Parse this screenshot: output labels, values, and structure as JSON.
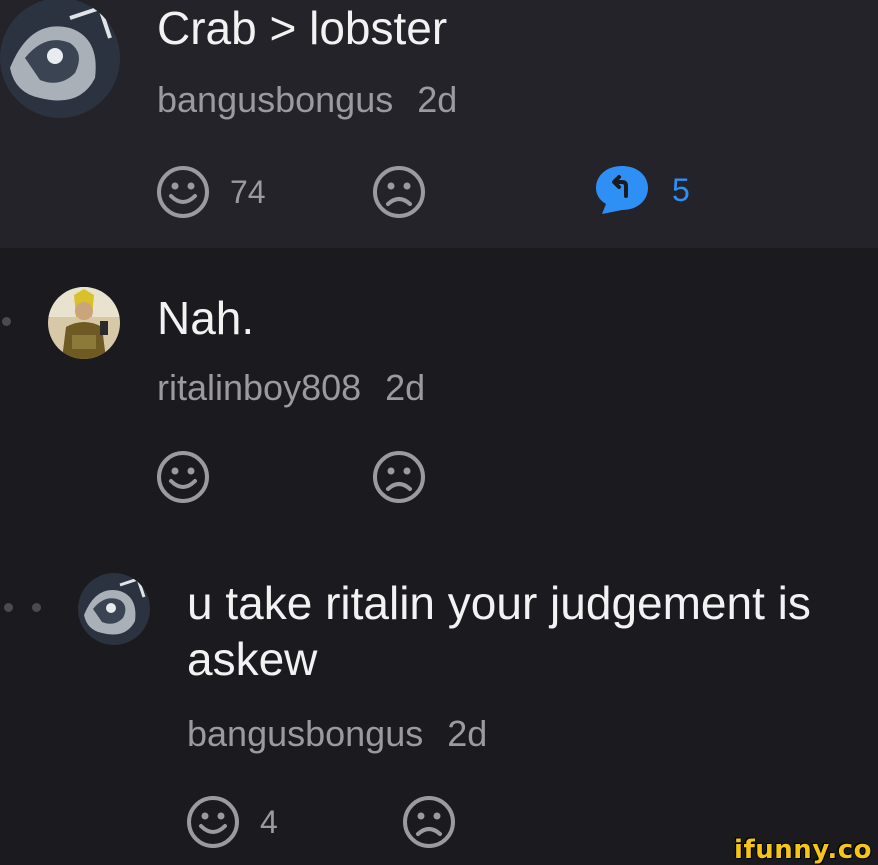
{
  "comments": [
    {
      "text": "Crab > lobster",
      "username": "bangusbongus",
      "time": "2d",
      "upvotes": "74",
      "replies": "5"
    },
    {
      "text": "Nah.",
      "username": "ritalinboy808",
      "time": "2d"
    },
    {
      "text": "u take ritalin your judgement is askew",
      "username": "bangusbongus",
      "time": "2d",
      "upvotes": "4"
    }
  ],
  "watermark": "ifunny.co",
  "colors": {
    "background": "#1b1b1f",
    "highlighted_comment_bg": "#232329",
    "reply_accent": "#2e8ff5",
    "watermark": "#f5c518"
  },
  "icons": [
    "smile-icon",
    "frown-icon",
    "reply-bubble-icon"
  ]
}
